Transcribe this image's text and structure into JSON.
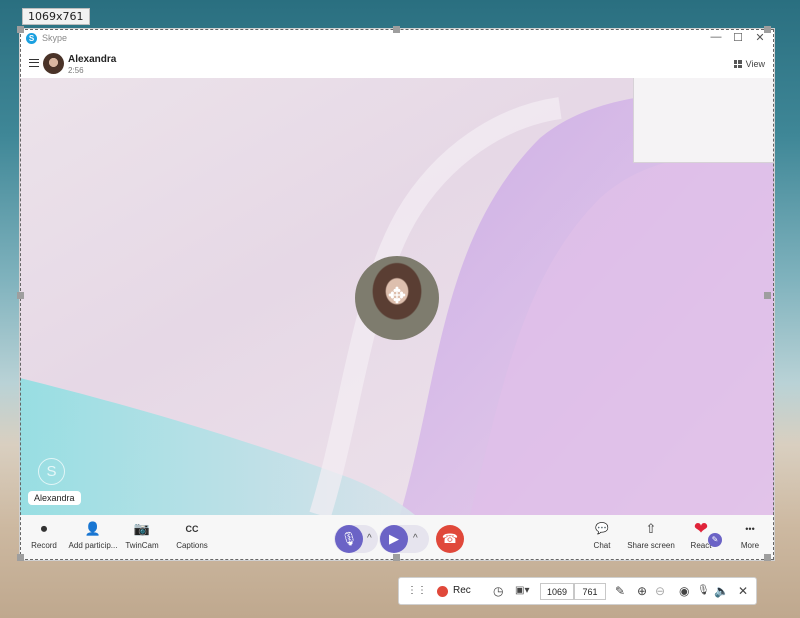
{
  "overlay": {
    "size_label": "1069x761"
  },
  "app": {
    "title": "Skype",
    "logo_glyph": "S",
    "window_controls": {
      "minimize": "—",
      "maximize": "☐",
      "close": "✕"
    }
  },
  "header": {
    "contact_name": "Alexandra",
    "call_time": "2:56",
    "view_label": "View"
  },
  "stage": {
    "participant_name": "Alexandra",
    "watermark_glyph": "S",
    "move_glyph": "✥"
  },
  "controls": {
    "left": [
      {
        "label": "Record",
        "icon": "record-icon",
        "glyph": "⏺"
      },
      {
        "label": "Add particip...",
        "icon": "add-participant-icon",
        "glyph": "👤"
      },
      {
        "label": "TwinCam",
        "icon": "twincam-icon",
        "glyph": "📷"
      },
      {
        "label": "Captions",
        "icon": "captions-icon",
        "glyph": "CC"
      }
    ],
    "center": {
      "mic_glyph": "🎙",
      "video_glyph": "▶",
      "chevron": "^",
      "end_glyph": "☎"
    },
    "right": [
      {
        "label": "Chat",
        "icon": "chat-icon",
        "glyph": "💬"
      },
      {
        "label": "Share screen",
        "icon": "share-screen-icon",
        "glyph": "⇧"
      },
      {
        "label": "React",
        "icon": "heart-icon",
        "glyph": "❤"
      },
      {
        "label": "More",
        "icon": "more-icon",
        "glyph": "•••"
      }
    ],
    "accent": "#6b63c6",
    "end_call_color": "#e0483a"
  },
  "recorder": {
    "drag_glyph": "⋮⋮",
    "rec_label": "Rec",
    "width_value": "1069",
    "height_value": "761",
    "icons": {
      "schedule": "◷",
      "region": "▣▾",
      "pen": "✎",
      "zoom_in": "⊕",
      "zoom_out": "⊖",
      "eye": "◉",
      "mic": "🎙",
      "speaker": "🔈",
      "close": "✕"
    }
  }
}
